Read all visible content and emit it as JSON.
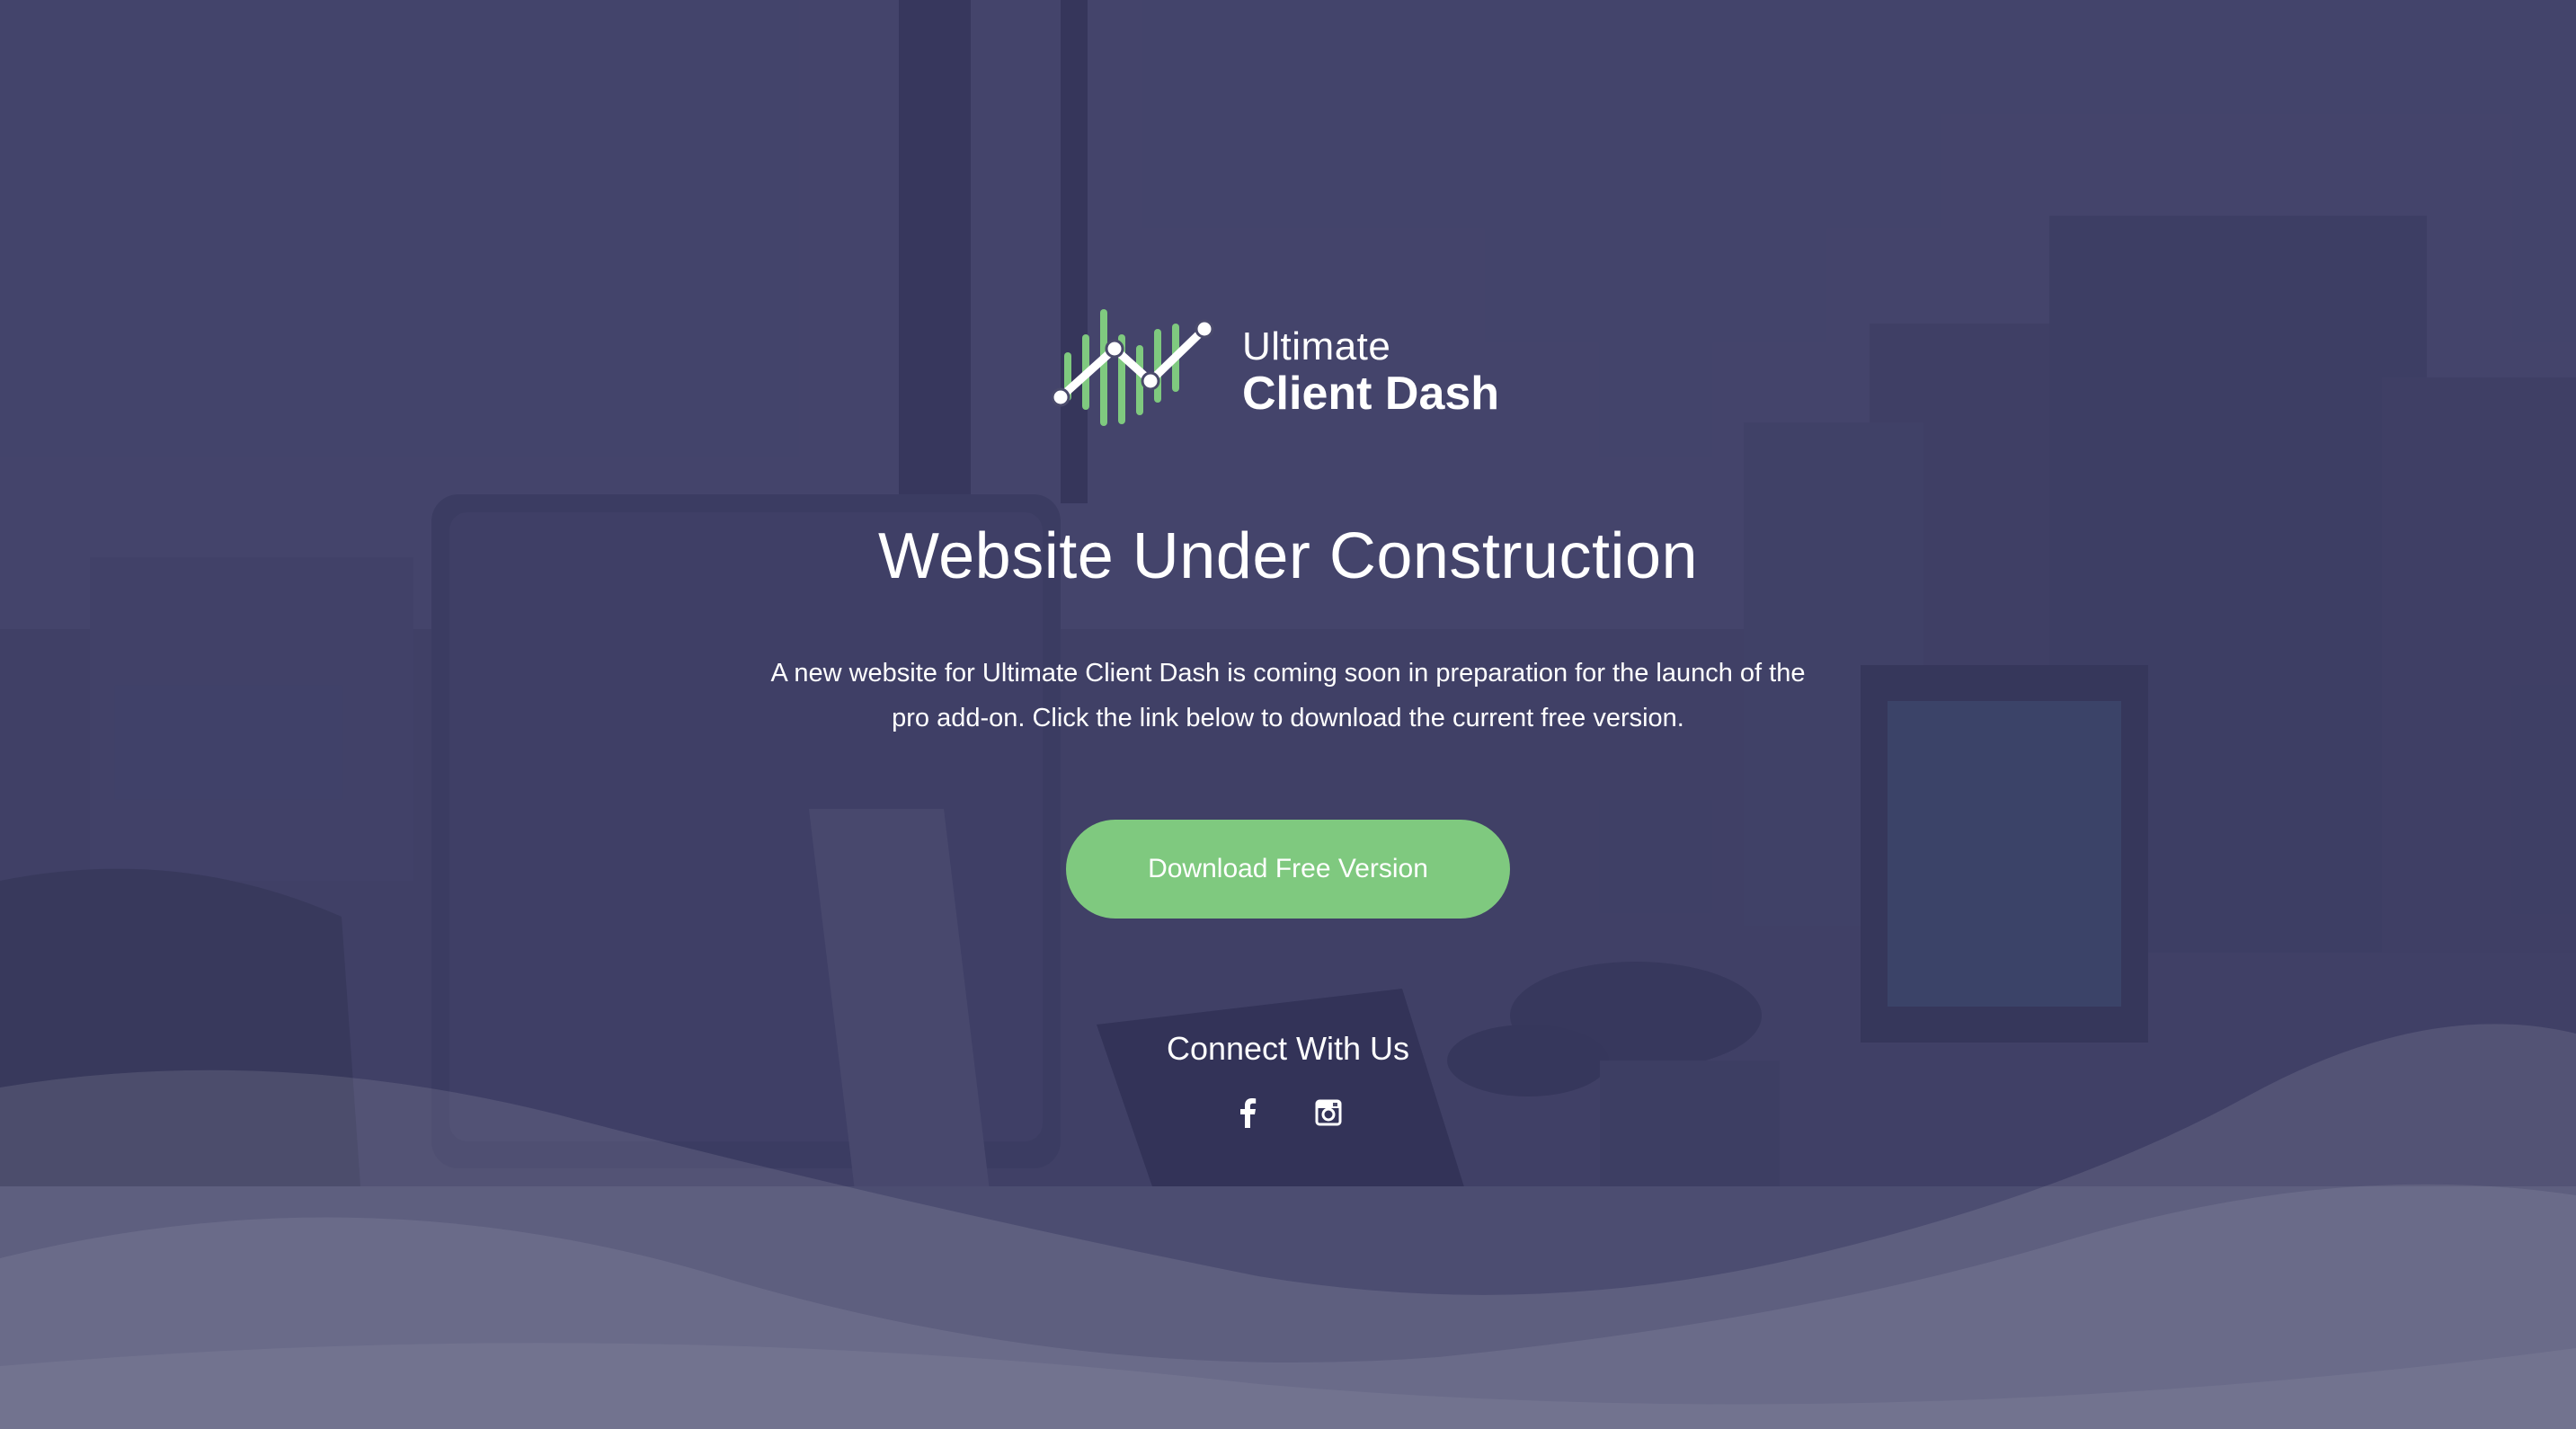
{
  "brand": {
    "line1": "Ultimate",
    "line2": "Client Dash",
    "accent_color": "#7fc97f",
    "logo_icon": "trend-chart-icon"
  },
  "main": {
    "title": "Website Under Construction",
    "description": "A new website for Ultimate Client Dash is coming soon in preparation for the launch of the pro add-on. Click the link below to download the current free version.",
    "cta_label": "Download Free Version"
  },
  "social": {
    "heading": "Connect With Us",
    "links": [
      {
        "icon": "facebook-icon"
      },
      {
        "icon": "instagram-icon"
      }
    ]
  },
  "colors": {
    "overlay": "#34345c",
    "button": "#7fc97f",
    "text": "#ffffff"
  }
}
